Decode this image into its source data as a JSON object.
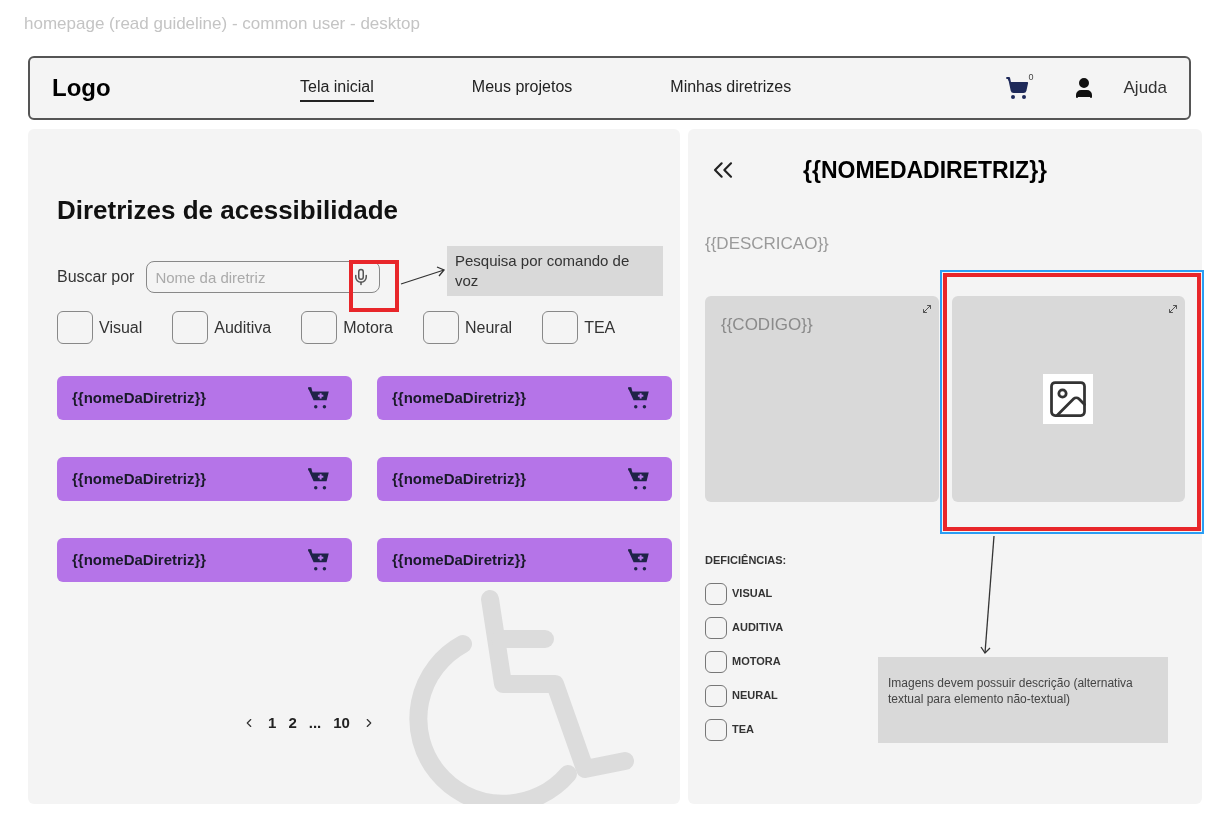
{
  "frame_title": "homepage (read guideline) - common user - desktop",
  "navbar": {
    "logo": "Logo",
    "links": [
      {
        "label": "Tela inicial",
        "selected": true
      },
      {
        "label": "Meus projetos",
        "selected": false
      },
      {
        "label": "Minhas diretrizes",
        "selected": false
      }
    ],
    "cart_count": "0",
    "help": "Ajuda"
  },
  "catalog": {
    "heading": "Diretrizes de acessibilidade",
    "search": {
      "label": "Buscar por",
      "placeholder": "Nome da diretriz"
    },
    "filters": [
      {
        "label": "Visual",
        "checked": false
      },
      {
        "label": "Auditiva",
        "checked": false
      },
      {
        "label": "Motora",
        "checked": false
      },
      {
        "label": "Neural",
        "checked": false
      },
      {
        "label": "TEA",
        "checked": false
      }
    ],
    "cards": [
      {
        "title": "{{nomeDaDiretriz}}"
      },
      {
        "title": "{{nomeDaDiretriz}}"
      },
      {
        "title": "{{nomeDaDiretriz}}"
      },
      {
        "title": "{{nomeDaDiretriz}}"
      },
      {
        "title": "{{nomeDaDiretriz}}"
      },
      {
        "title": "{{nomeDaDiretriz}}"
      }
    ],
    "pagination": {
      "pages": [
        "1",
        "2",
        "...",
        "10"
      ]
    }
  },
  "detail": {
    "title": "{{NOMEDADIRETRIZ}}",
    "description": "{{DESCRICAO}}",
    "code": "{{CODIGO}}",
    "deficiencies_heading": "DEFICIÊNCIAS:",
    "deficiencies": [
      {
        "label": "VISUAL",
        "checked": false
      },
      {
        "label": "AUDITIVA",
        "checked": false
      },
      {
        "label": "MOTORA",
        "checked": false
      },
      {
        "label": "NEURAL",
        "checked": false
      },
      {
        "label": "TEA",
        "checked": false
      }
    ]
  },
  "annotations": [
    {
      "text": "Pesquisa por comando de voz"
    },
    {
      "text": "Imagens devem possuir descrição (alternativa textual para elemento não-textual)"
    }
  ]
}
